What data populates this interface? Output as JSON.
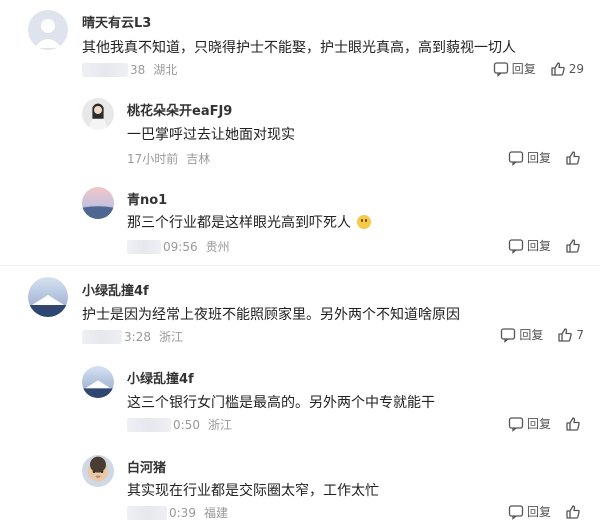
{
  "comments": [
    {
      "user": "晴天有云L3",
      "text": "其他我真不知道，只晓得护士不能娶，护士眼光真高，高到藐视一切人",
      "time": "38",
      "location": "湖北",
      "reply_label": "回复",
      "like_count": "29"
    },
    {
      "user": "桃花朵朵开eaFJ9",
      "text": "一巴掌呼过去让她面对现实",
      "time": "17小时前",
      "location": "吉林",
      "reply_label": "回复",
      "like_count": ""
    },
    {
      "user": "青no1",
      "text": "那三个行业都是这样眼光高到吓死人",
      "time": "09:56",
      "location": "贵州",
      "reply_label": "回复",
      "like_count": ""
    },
    {
      "user": "小绿乱撞4f",
      "text": "护士是因为经常上夜班不能照顾家里。另外两个不知道啥原因",
      "time": "3:28",
      "location": "浙江",
      "reply_label": "回复",
      "like_count": "7"
    },
    {
      "user": "小绿乱撞4f",
      "text": "这三个银行女门槛是最高的。另外两个中专就能干",
      "time": "0:50",
      "location": "浙江",
      "reply_label": "回复",
      "like_count": ""
    },
    {
      "user": "白河猪",
      "text": "其实现在行业都是交际圈太窄，工作太忙",
      "time": "0:39",
      "location": "福建",
      "reply_label": "回复",
      "like_count": ""
    }
  ],
  "colors": {
    "meta": "#999999",
    "text": "#222222",
    "username": "#333333"
  },
  "icons": [
    "reply-icon",
    "thumbs-up-icon",
    "smile-emoji-icon"
  ]
}
